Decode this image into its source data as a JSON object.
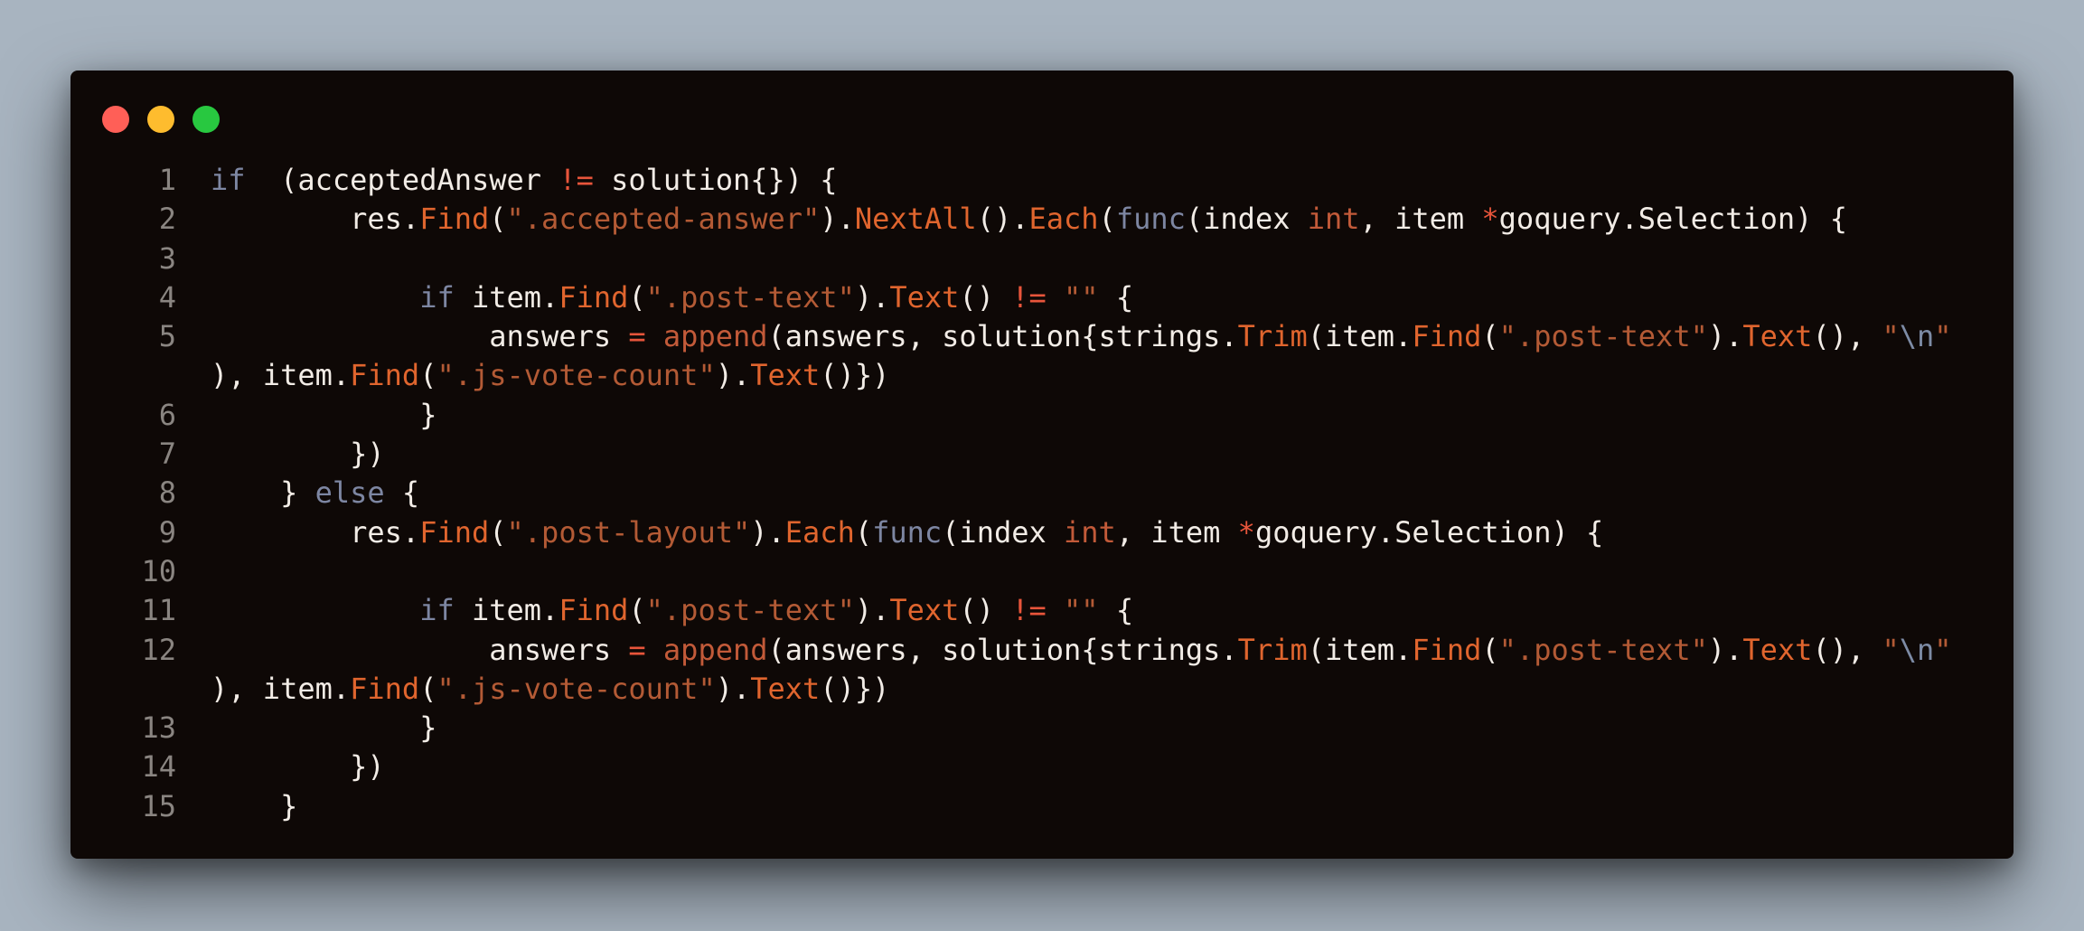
{
  "window": {
    "traffic_lights": [
      {
        "name": "close",
        "color": "#ff5f57"
      },
      {
        "name": "minimize",
        "color": "#febc2e"
      },
      {
        "name": "maximize",
        "color": "#28c840"
      }
    ]
  },
  "theme": {
    "background": "#0e0806",
    "text": "#f2ece6",
    "keyword": "#7d86a2",
    "function": "#e0652e",
    "string": "#b35a35",
    "operator": "#e8553b",
    "type": "#c25a39",
    "line_number": "#8a8581"
  },
  "code": {
    "language": "go",
    "rows": [
      {
        "num": "1",
        "tokens": [
          [
            "kw",
            "if"
          ],
          [
            "",
            "  (acceptedAnswer "
          ],
          [
            "op",
            "!="
          ],
          [
            "",
            " solution{}) {"
          ]
        ]
      },
      {
        "num": "2",
        "tokens": [
          [
            "",
            "        res."
          ],
          [
            "fn",
            "Find"
          ],
          [
            "",
            "("
          ],
          [
            "str",
            "\".accepted-answer\""
          ],
          [
            "",
            ")."
          ],
          [
            "fn",
            "NextAll"
          ],
          [
            "",
            "()."
          ],
          [
            "fn",
            "Each"
          ],
          [
            "",
            "("
          ],
          [
            "kw",
            "func"
          ],
          [
            "",
            "(index "
          ],
          [
            "ty",
            "int"
          ],
          [
            "",
            ", item "
          ],
          [
            "op",
            "*"
          ],
          [
            "",
            "goquery.Selection) {"
          ]
        ]
      },
      {
        "num": "3",
        "tokens": []
      },
      {
        "num": "4",
        "tokens": [
          [
            "",
            "            "
          ],
          [
            "kw",
            "if"
          ],
          [
            "",
            " item."
          ],
          [
            "fn",
            "Find"
          ],
          [
            "",
            "("
          ],
          [
            "str",
            "\".post-text\""
          ],
          [
            "",
            ")."
          ],
          [
            "fn",
            "Text"
          ],
          [
            "",
            "() "
          ],
          [
            "op",
            "!="
          ],
          [
            "",
            " "
          ],
          [
            "str",
            "\"\""
          ],
          [
            "",
            " {"
          ]
        ]
      },
      {
        "num": "5",
        "tokens": [
          [
            "",
            "                answers "
          ],
          [
            "op",
            "="
          ],
          [
            "",
            " "
          ],
          [
            "ty",
            "append"
          ],
          [
            "",
            "(answers, solution{strings."
          ],
          [
            "fn",
            "Trim"
          ],
          [
            "",
            "(item."
          ],
          [
            "fn",
            "Find"
          ],
          [
            "",
            "("
          ],
          [
            "str",
            "\".post-text\""
          ],
          [
            "",
            ")."
          ],
          [
            "fn",
            "Text"
          ],
          [
            "",
            "(), "
          ],
          [
            "str",
            "\""
          ],
          [
            "esc",
            "\\n"
          ],
          [
            "str",
            "\""
          ]
        ]
      },
      {
        "num": "",
        "tokens": [
          [
            "",
            "), item."
          ],
          [
            "fn",
            "Find"
          ],
          [
            "",
            "("
          ],
          [
            "str",
            "\".js-vote-count\""
          ],
          [
            "",
            ")."
          ],
          [
            "fn",
            "Text"
          ],
          [
            "",
            "()})"
          ]
        ]
      },
      {
        "num": "6",
        "tokens": [
          [
            "",
            "            }"
          ]
        ]
      },
      {
        "num": "7",
        "tokens": [
          [
            "",
            "        })"
          ]
        ]
      },
      {
        "num": "8",
        "tokens": [
          [
            "",
            "    } "
          ],
          [
            "kw",
            "else"
          ],
          [
            "",
            " {"
          ]
        ]
      },
      {
        "num": "9",
        "tokens": [
          [
            "",
            "        res."
          ],
          [
            "fn",
            "Find"
          ],
          [
            "",
            "("
          ],
          [
            "str",
            "\".post-layout\""
          ],
          [
            "",
            ")."
          ],
          [
            "fn",
            "Each"
          ],
          [
            "",
            "("
          ],
          [
            "kw",
            "func"
          ],
          [
            "",
            "(index "
          ],
          [
            "ty",
            "int"
          ],
          [
            "",
            ", item "
          ],
          [
            "op",
            "*"
          ],
          [
            "",
            "goquery.Selection) {"
          ]
        ]
      },
      {
        "num": "10",
        "tokens": []
      },
      {
        "num": "11",
        "tokens": [
          [
            "",
            "            "
          ],
          [
            "kw",
            "if"
          ],
          [
            "",
            " item."
          ],
          [
            "fn",
            "Find"
          ],
          [
            "",
            "("
          ],
          [
            "str",
            "\".post-text\""
          ],
          [
            "",
            ")."
          ],
          [
            "fn",
            "Text"
          ],
          [
            "",
            "() "
          ],
          [
            "op",
            "!="
          ],
          [
            "",
            " "
          ],
          [
            "str",
            "\"\""
          ],
          [
            "",
            " {"
          ]
        ]
      },
      {
        "num": "12",
        "tokens": [
          [
            "",
            "                answers "
          ],
          [
            "op",
            "="
          ],
          [
            "",
            " "
          ],
          [
            "ty",
            "append"
          ],
          [
            "",
            "(answers, solution{strings."
          ],
          [
            "fn",
            "Trim"
          ],
          [
            "",
            "(item."
          ],
          [
            "fn",
            "Find"
          ],
          [
            "",
            "("
          ],
          [
            "str",
            "\".post-text\""
          ],
          [
            "",
            ")."
          ],
          [
            "fn",
            "Text"
          ],
          [
            "",
            "(), "
          ],
          [
            "str",
            "\""
          ],
          [
            "esc",
            "\\n"
          ],
          [
            "str",
            "\""
          ]
        ]
      },
      {
        "num": "",
        "tokens": [
          [
            "",
            "), item."
          ],
          [
            "fn",
            "Find"
          ],
          [
            "",
            "("
          ],
          [
            "str",
            "\".js-vote-count\""
          ],
          [
            "",
            ")."
          ],
          [
            "fn",
            "Text"
          ],
          [
            "",
            "()})"
          ]
        ]
      },
      {
        "num": "13",
        "tokens": [
          [
            "",
            "            }"
          ]
        ]
      },
      {
        "num": "14",
        "tokens": [
          [
            "",
            "        })"
          ]
        ]
      },
      {
        "num": "15",
        "tokens": [
          [
            "",
            "    }"
          ]
        ]
      }
    ]
  }
}
